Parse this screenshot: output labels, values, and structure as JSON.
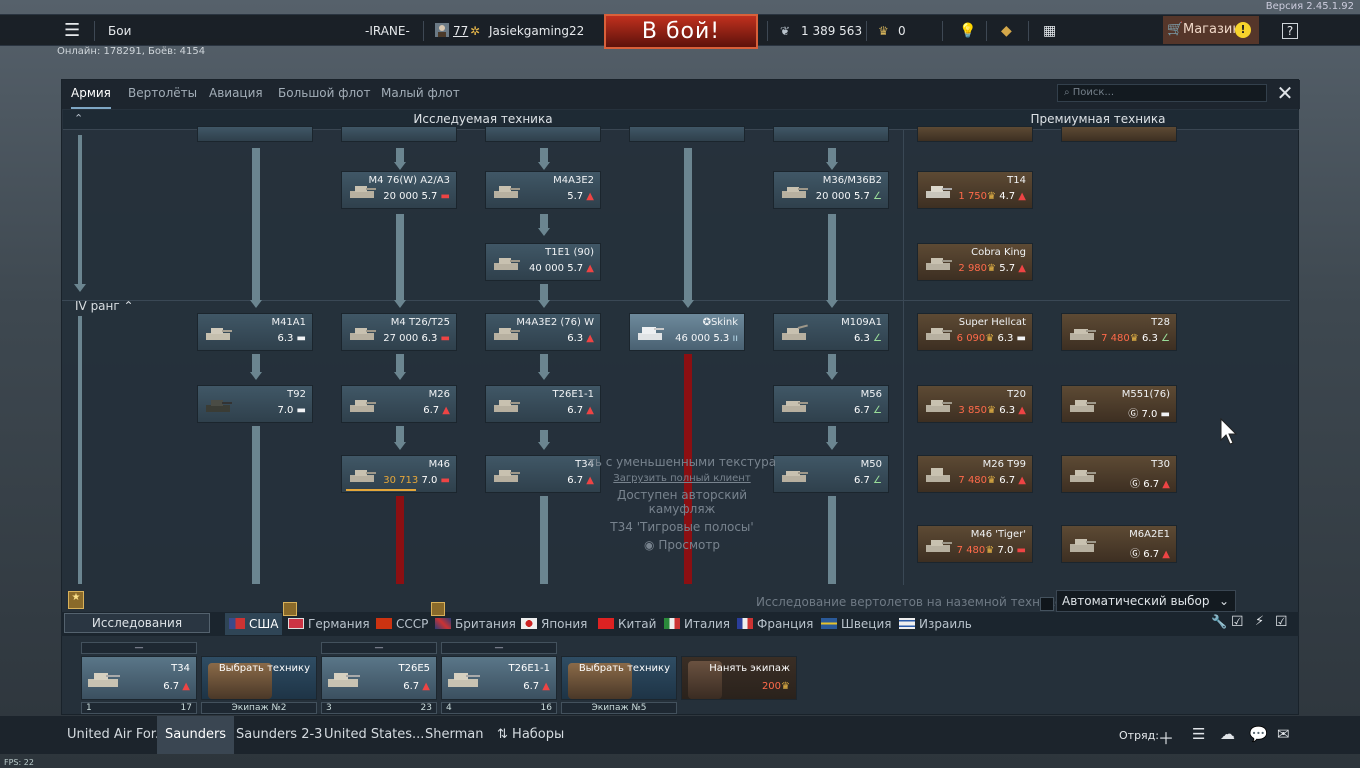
{
  "version": "Версия 2.45.1.92",
  "topbar": {
    "mode": "Бои",
    "clan": "-IRANE-",
    "level": "77",
    "username": "Jasiekgaming22",
    "battle_button": "В бой!",
    "silver": "1 389 563",
    "gold": "0",
    "shop": "Магазин",
    "shop_warn": "!",
    "help": "?"
  },
  "online": "Онлайн: 178291, Боёв: 4154",
  "tabs": [
    "Армия",
    "Вертолёты",
    "Авиация",
    "Большой флот",
    "Малый флот"
  ],
  "search_placeholder": "Поиск...",
  "columns": {
    "research": "Исследуемая техника",
    "premium": "Премиумная техника"
  },
  "rank_label": "IV ранг",
  "overlay": {
    "line1": "ть с уменьшенными текстура",
    "line2": "Загрузить полный клиент",
    "line3": "Доступен авторский камуфляж",
    "line4": "T34 'Тигровые полосы'",
    "line5": "Просмотр"
  },
  "vehicles": {
    "m4_76w": {
      "name": "M4 76(W) A2/A3",
      "cost": "20 000",
      "br": "5.7"
    },
    "m4a3e2": {
      "name": "M4A3E2",
      "br": "5.7"
    },
    "m36": {
      "name": "M36/M36B2",
      "cost": "20 000",
      "br": "5.7"
    },
    "t1e1": {
      "name": "T1E1 (90)",
      "cost": "40 000",
      "br": "5.7"
    },
    "m41a1": {
      "name": "M41A1",
      "br": "6.3"
    },
    "m4t26": {
      "name": "M4 T26/T25",
      "cost": "27 000",
      "br": "6.3"
    },
    "m4a3e2_76": {
      "name": "M4A3E2 (76) W",
      "br": "6.3"
    },
    "skink": {
      "name": "✪Skink",
      "cost": "46 000",
      "br": "5.3"
    },
    "m109a1": {
      "name": "M109A1",
      "br": "6.3"
    },
    "t92": {
      "name": "T92",
      "br": "7.0"
    },
    "m26": {
      "name": "M26",
      "br": "6.7"
    },
    "t26e1": {
      "name": "T26E1-1",
      "br": "6.7"
    },
    "m56": {
      "name": "M56",
      "br": "6.7"
    },
    "m46": {
      "name": "M46",
      "cost": "30 713",
      "br": "7.0"
    },
    "t34": {
      "name": "T34",
      "br": "6.7"
    },
    "m50": {
      "name": "M50",
      "br": "6.7"
    }
  },
  "premium": {
    "t14": {
      "name": "T14",
      "cost": "1 750",
      "br": "4.7"
    },
    "cobra": {
      "name": "Cobra King",
      "cost": "2 980",
      "br": "5.7"
    },
    "hellcat": {
      "name": "Super Hellcat",
      "cost": "6 090",
      "br": "6.3"
    },
    "t28": {
      "name": "T28",
      "cost": "7 480",
      "br": "6.3"
    },
    "t20": {
      "name": "T20",
      "cost": "3 850",
      "br": "6.3"
    },
    "m551": {
      "name": "M551(76)",
      "cost": "Ⓖ",
      "br": "7.0"
    },
    "m26t99": {
      "name": "M26 T99",
      "cost": "7 480",
      "br": "6.7"
    },
    "t30": {
      "name": "T30",
      "cost": "Ⓖ",
      "br": "6.7"
    },
    "m46tiger": {
      "name": "M46 'Tiger'",
      "cost": "7 480",
      "br": "7.0"
    },
    "m6a2e1": {
      "name": "M6A2E1",
      "cost": "Ⓖ",
      "br": "6.7"
    }
  },
  "heli_research": "Исследование вертолетов на наземной технике",
  "auto_select": "Автоматический выбор",
  "research_button": "Исследования",
  "nations": [
    "США",
    "Германия",
    "СССР",
    "Британия",
    "Япония",
    "Китай",
    "Италия",
    "Франция",
    "Швеция",
    "Израиль"
  ],
  "crew": [
    {
      "hdr": "—",
      "name": "T34",
      "br": "6.7",
      "slot": "1",
      "lvl": "17"
    },
    {
      "hdr": "",
      "name": "Выбрать технику",
      "footer": "Экипаж №2"
    },
    {
      "hdr": "—",
      "name": "T26E5",
      "br": "6.7",
      "slot": "3",
      "lvl": "23"
    },
    {
      "hdr": "—",
      "name": "T26E1-1",
      "br": "6.7",
      "slot": "4",
      "lvl": "16"
    },
    {
      "hdr": "",
      "name": "Выбрать технику",
      "footer": "Экипаж №5"
    },
    {
      "hdr": "",
      "name": "Нанять экипаж",
      "cost": "200"
    }
  ],
  "presets": [
    "United Air For...",
    "Saunders",
    "Saunders 2-3",
    "United States...",
    "Sherman",
    "Наборы"
  ],
  "squad": "Отряд:",
  "fps": "FPS: 22",
  "colors": {
    "accent": "#7fa6c4",
    "battle": "#c0301e",
    "premium_cost": "#ff6a4a",
    "gold": "#f6d32c"
  }
}
